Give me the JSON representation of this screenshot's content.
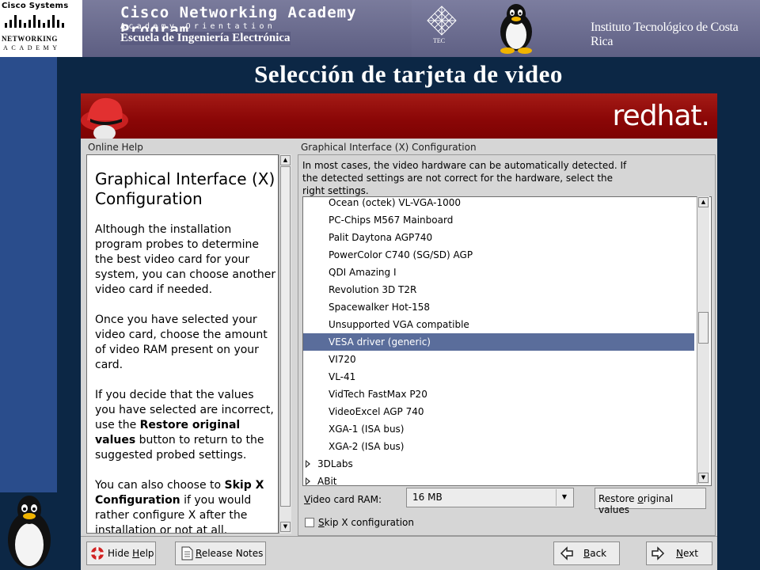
{
  "slide": {
    "cisco_logo_text": "Cisco Systems",
    "cisco_networking": "NETWORKING",
    "cisco_academy": "ACADEMY",
    "cnap_title": "Cisco Networking Academy Program",
    "cnap_subtitle": "Academy Orientation",
    "school": "Escuela de Ingeniería Electrónica",
    "tec_caption": "TEC",
    "institute": "Instituto Tecnológico de Costa Rica",
    "title": "Selección de tarjeta de video"
  },
  "installer": {
    "brand": "redhat.",
    "online_help_label": "Online Help",
    "help": {
      "heading": "Graphical Interface (X) Configuration",
      "p1": "Although the installation program probes to determine the best video card for your system, you can choose another video card if needed.",
      "p2": "Once you have selected your video card, choose the amount of video RAM present on your card.",
      "p3_a": "If you decide that the values you have selected are incorrect, use the ",
      "p3_b": "Restore original values",
      "p3_c": " button to return to the suggested probed settings.",
      "p4_a": "You can also choose to ",
      "p4_b": "Skip X Configuration",
      "p4_c": " if you would rather configure X after the installation or not at all."
    },
    "x_config_label": "Graphical Interface (X) Configuration",
    "intro": "In most cases, the video hardware can be automatically detected. If the detected settings are not correct for the hardware, select the right settings.",
    "video_cards": [
      {
        "label": "Ocean (octek) VL-VGA-1000",
        "group": false,
        "selected": false
      },
      {
        "label": "PC-Chips M567 Mainboard",
        "group": false,
        "selected": false
      },
      {
        "label": "Palit Daytona AGP740",
        "group": false,
        "selected": false
      },
      {
        "label": "PowerColor C740 (SG/SD) AGP",
        "group": false,
        "selected": false
      },
      {
        "label": "QDI Amazing I",
        "group": false,
        "selected": false
      },
      {
        "label": "Revolution 3D T2R",
        "group": false,
        "selected": false
      },
      {
        "label": "Spacewalker Hot-158",
        "group": false,
        "selected": false
      },
      {
        "label": "Unsupported VGA compatible",
        "group": false,
        "selected": false
      },
      {
        "label": "VESA driver (generic)",
        "group": false,
        "selected": true
      },
      {
        "label": "VI720",
        "group": false,
        "selected": false
      },
      {
        "label": "VL-41",
        "group": false,
        "selected": false
      },
      {
        "label": "VidTech FastMax P20",
        "group": false,
        "selected": false
      },
      {
        "label": "VideoExcel AGP 740",
        "group": false,
        "selected": false
      },
      {
        "label": "XGA-1  (ISA bus)",
        "group": false,
        "selected": false
      },
      {
        "label": "XGA-2  (ISA bus)",
        "group": false,
        "selected": false
      },
      {
        "label": "3DLabs",
        "group": true,
        "selected": false
      },
      {
        "label": "ABit",
        "group": true,
        "selected": false
      }
    ],
    "video_ram_label": "Video card RAM:",
    "video_ram_value": "16 MB",
    "restore_button": "Restore original values",
    "skip_label": "Skip X configuration",
    "skip_checked": false,
    "buttons": {
      "hide_help": "Hide Help",
      "release_notes": "Release Notes",
      "back": "Back",
      "next": "Next"
    }
  }
}
